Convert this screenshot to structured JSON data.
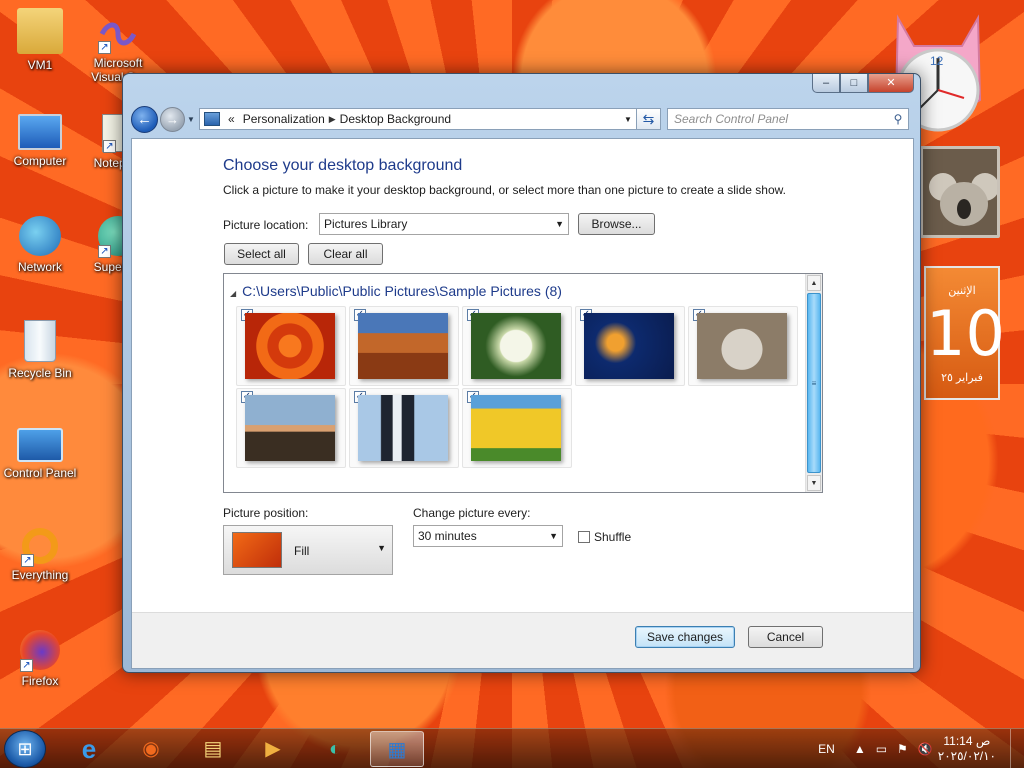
{
  "desktop": {
    "icons": [
      {
        "label": "VM1",
        "icon": "folder-user-icon"
      },
      {
        "label": "Microsoft Visual S...",
        "icon": "visual-studio-icon"
      },
      {
        "label": "Computer",
        "icon": "computer-icon"
      },
      {
        "label": "Notepa...",
        "icon": "notepad-icon"
      },
      {
        "label": "Network",
        "icon": "network-icon"
      },
      {
        "label": "Supern...",
        "icon": "supernotes-icon"
      },
      {
        "label": "Recycle Bin",
        "icon": "recycle-bin-icon"
      },
      {
        "label": "Control Panel",
        "icon": "control-panel-icon"
      },
      {
        "label": "Everything",
        "icon": "everything-icon"
      },
      {
        "label": "Firefox",
        "icon": "firefox-icon"
      }
    ]
  },
  "gadgets": {
    "calendar": {
      "top": "الإثنين",
      "day": "10",
      "bottom": "فبراير ٢٥"
    },
    "clock_number": "12"
  },
  "window": {
    "controls": {
      "minimize": "–",
      "maximize": "□",
      "close": "✕"
    },
    "address": {
      "prefix": "«",
      "crumbs": [
        "Personalization",
        "Desktop Background"
      ]
    },
    "search_placeholder": "Search Control Panel",
    "heading": "Choose your desktop background",
    "subtext": "Click a picture to make it your desktop background, or select more than one picture to create a slide show.",
    "picture_location": {
      "label": "Picture location:",
      "value": "Pictures Library"
    },
    "browse_label": "Browse...",
    "select_all_label": "Select all",
    "clear_all_label": "Clear all",
    "gallery": {
      "path": "C:\\Users\\Public\\Public Pictures\\Sample Pictures (8)",
      "pictures": [
        {
          "name": "Chrysanthemum",
          "checked": true,
          "colors": [
            "#e84414",
            "#b82608"
          ]
        },
        {
          "name": "Desert",
          "checked": true,
          "colors": [
            "#4a77b8",
            "#b5541f"
          ]
        },
        {
          "name": "Hydrangeas",
          "checked": true,
          "colors": [
            "#2f5c23",
            "#e8ecd8"
          ]
        },
        {
          "name": "Jellyfish",
          "checked": true,
          "colors": [
            "#0d2a6e",
            "#e88a20"
          ]
        },
        {
          "name": "Koala",
          "checked": true,
          "colors": [
            "#8c7c68",
            "#d8d2c8"
          ]
        },
        {
          "name": "Lighthouse",
          "checked": true,
          "colors": [
            "#8fb0d0",
            "#3a2e22"
          ]
        },
        {
          "name": "Penguins",
          "checked": true,
          "colors": [
            "#a9c8e6",
            "#1e2430"
          ]
        },
        {
          "name": "Tulips",
          "checked": true,
          "colors": [
            "#e8c020",
            "#5aa0d8"
          ]
        }
      ]
    },
    "picture_position": {
      "label": "Picture position:",
      "value": "Fill"
    },
    "change_every": {
      "label": "Change picture every:",
      "value": "30 minutes"
    },
    "shuffle": {
      "label": "Shuffle",
      "checked": false
    },
    "save_label": "Save changes",
    "cancel_label": "Cancel"
  },
  "taskbar": {
    "apps": [
      {
        "name": "internet-explorer",
        "glyph": "e"
      },
      {
        "name": "firefox",
        "glyph": "◉"
      },
      {
        "name": "file-explorer",
        "glyph": "▤"
      },
      {
        "name": "media-player",
        "glyph": "▶"
      },
      {
        "name": "supernotes",
        "glyph": "◐"
      },
      {
        "name": "control-panel",
        "glyph": "▦"
      }
    ],
    "language": "EN",
    "time": "11:14 ص",
    "date": "٢٠٢٥/٠٢/١٠"
  }
}
